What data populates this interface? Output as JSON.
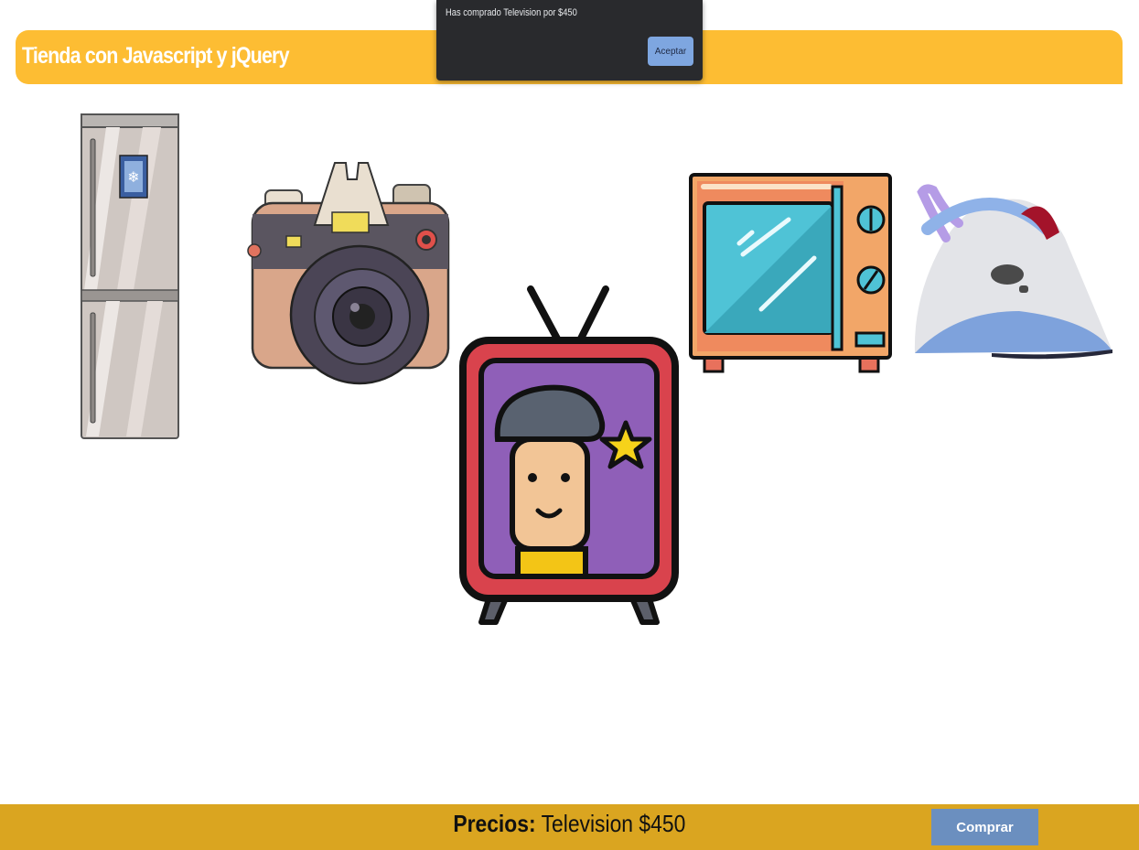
{
  "header": {
    "title": "Tienda con Javascript y jQuery"
  },
  "products": [
    {
      "icon": "refrigerator-icon"
    },
    {
      "icon": "camera-icon"
    },
    {
      "icon": "television-icon"
    },
    {
      "icon": "microwave-icon"
    },
    {
      "icon": "iron-icon"
    }
  ],
  "footer": {
    "prices_label": "Precios:",
    "prices_value": "Television $450",
    "buy_label": "Comprar"
  },
  "alert": {
    "message": "Has comprado Television por $450",
    "ok_label": "Aceptar"
  },
  "colors": {
    "header": "#fdbd33",
    "footer": "#daa520",
    "buy_button": "#6b8fbf",
    "alert_bg": "#292a2d",
    "alert_button": "#7ea6e0"
  }
}
